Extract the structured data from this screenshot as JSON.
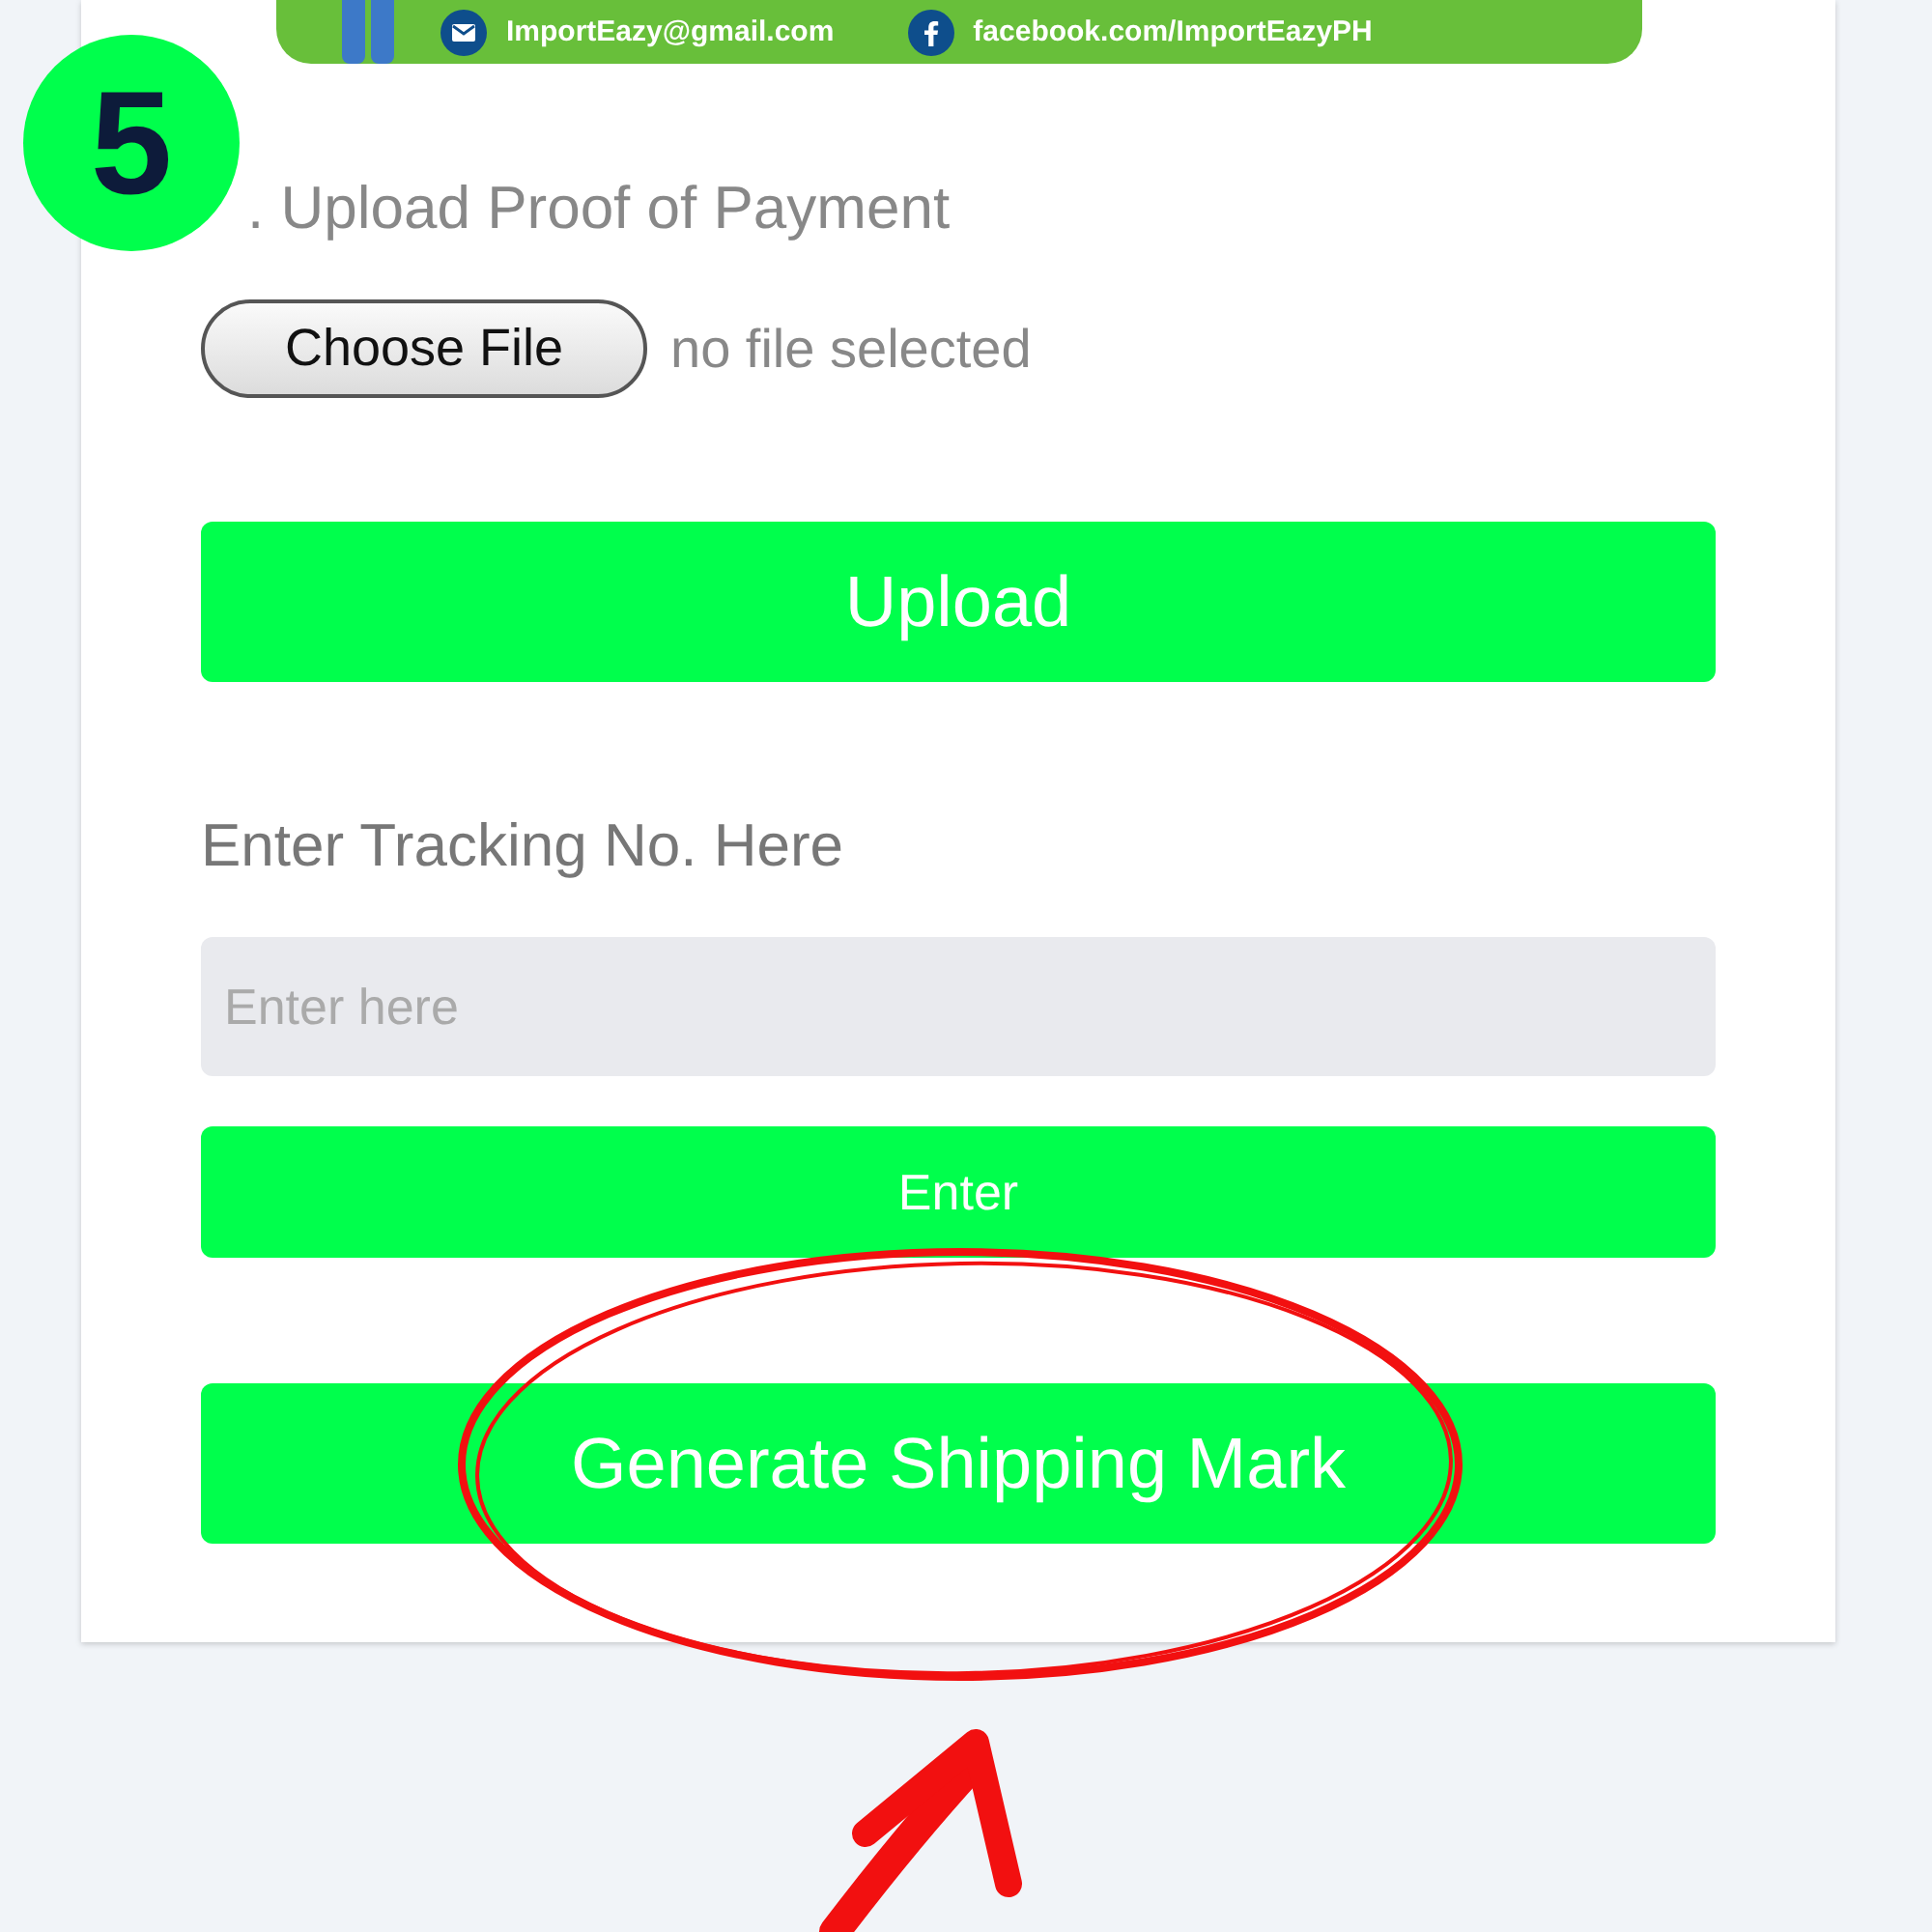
{
  "step_badge": {
    "text": "5"
  },
  "banner": {
    "contacts": [
      {
        "kind": "email",
        "text": "ImportEazy@gmail.com"
      },
      {
        "kind": "facebook",
        "text": "facebook.com/ImportEazyPH"
      }
    ]
  },
  "heading": ". Upload Proof of Payment",
  "file_input": {
    "button": "Choose File",
    "status": "no file selected"
  },
  "upload_button": "Upload",
  "tracking": {
    "label": "Enter Tracking No. Here",
    "placeholder": "Enter here"
  },
  "enter_button": "Enter",
  "generate_button": "Generate Shipping Mark"
}
